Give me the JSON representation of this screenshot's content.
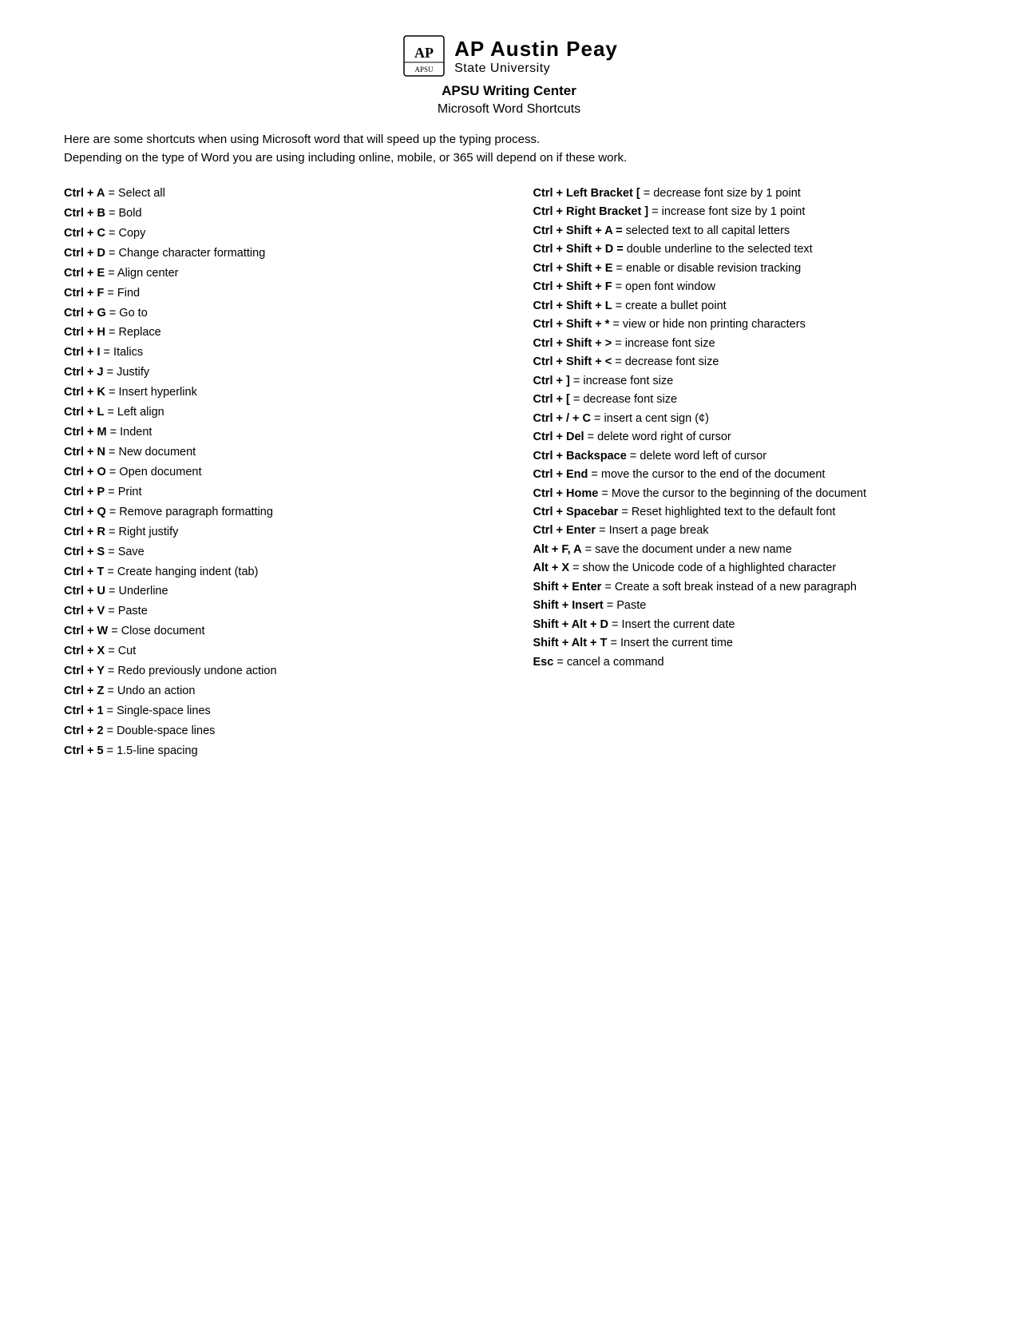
{
  "header": {
    "logo_apsu": "AP Austin Peay",
    "logo_state": "State University",
    "center_title": "APSU Writing Center",
    "sub_title": "Microsoft Word Shortcuts"
  },
  "intro": {
    "line1": "Here are some shortcuts when using Microsoft word that will speed up the typing process.",
    "line2": "Depending on the type of Word you are using including online, mobile, or 365 will depend on if these work."
  },
  "left_shortcuts": [
    {
      "key": "Ctrl + A",
      "desc": "= Select all"
    },
    {
      "key": "Ctrl + B",
      "desc": "= Bold"
    },
    {
      "key": "Ctrl + C",
      "desc": "= Copy"
    },
    {
      "key": "Ctrl + D",
      "desc": "= Change character formatting"
    },
    {
      "key": "Ctrl + E",
      "desc": "= Align center"
    },
    {
      "key": "Ctrl + F",
      "desc": "= Find"
    },
    {
      "key": "Ctrl + G",
      "desc": "= Go to"
    },
    {
      "key": "Ctrl + H",
      "desc": "= Replace"
    },
    {
      "key": "Ctrl + I",
      "desc": "= Italics"
    },
    {
      "key": "Ctrl + J",
      "desc": "= Justify"
    },
    {
      "key": "Ctrl + K",
      "desc": "= Insert hyperlink"
    },
    {
      "key": "Ctrl + L",
      "desc": "= Left align"
    },
    {
      "key": "Ctrl + M",
      "desc": "= Indent"
    },
    {
      "key": "Ctrl + N",
      "desc": "= New document"
    },
    {
      "key": "Ctrl + O",
      "desc": "= Open document"
    },
    {
      "key": "Ctrl + P",
      "desc": "= Print"
    },
    {
      "key": "Ctrl + Q",
      "desc": "= Remove paragraph formatting"
    },
    {
      "key": "Ctrl + R",
      "desc": "= Right justify"
    },
    {
      "key": "Ctrl + S",
      "desc": "= Save"
    },
    {
      "key": "Ctrl + T",
      "desc": "= Create hanging indent (tab)"
    },
    {
      "key": "Ctrl + U",
      "desc": "= Underline"
    },
    {
      "key": "Ctrl + V",
      "desc": "= Paste"
    },
    {
      "key": "Ctrl + W",
      "desc": "= Close document"
    },
    {
      "key": "Ctrl + X",
      "desc": "= Cut"
    },
    {
      "key": "Ctrl + Y",
      "desc": "= Redo previously undone action"
    },
    {
      "key": "Ctrl + Z",
      "desc": "= Undo an action"
    },
    {
      "key": "Ctrl + 1",
      "desc": "= Single-space lines"
    },
    {
      "key": "Ctrl + 2",
      "desc": "= Double-space lines"
    },
    {
      "key": "Ctrl + 5",
      "desc": "= 1.5-line spacing"
    }
  ],
  "right_shortcuts": [
    {
      "key": "Ctrl + Left Bracket [",
      "desc": "= decrease font size by 1 point"
    },
    {
      "key": "Ctrl + Right Bracket ]",
      "desc": "= increase font size by 1 point"
    },
    {
      "key": "Ctrl + Shift + A = ",
      "desc": " selected text to all capital letters"
    },
    {
      "key": "Ctrl + Shift + D = ",
      "desc": " double underline to the selected text"
    },
    {
      "key": "Ctrl + Shift + E",
      "desc": "= enable or disable revision tracking"
    },
    {
      "key": "Ctrl + Shift + F",
      "desc": "= open font window"
    },
    {
      "key": "Ctrl + Shift + L",
      "desc": "= create a bullet point"
    },
    {
      "key": "Ctrl + Shift + *",
      "desc": "= view or hide non printing characters"
    },
    {
      "key": "Ctrl + Shift + >",
      "desc": "= increase font size"
    },
    {
      "key": "Ctrl + Shift + <",
      "desc": "= decrease font size"
    },
    {
      "key": "Ctrl + ]",
      "desc": "= increase font size"
    },
    {
      "key": "Ctrl + [",
      "desc": "= decrease font size"
    },
    {
      "key": "Ctrl + / + C",
      "desc": "= insert a cent sign (¢)"
    },
    {
      "key": "Ctrl + Del",
      "desc": "= delete word right of cursor"
    },
    {
      "key": "Ctrl + Backspace",
      "desc": "= delete word left of cursor"
    },
    {
      "key": "Ctrl + End",
      "desc": "= move the cursor to the end of the document"
    },
    {
      "key": "Ctrl + Home",
      "desc": "= Move the cursor to the beginning of the document"
    },
    {
      "key": "Ctrl + Spacebar",
      "desc": "= Reset highlighted text to the default font"
    },
    {
      "key": "Ctrl + Enter",
      "desc": "= Insert a page break"
    },
    {
      "key": "Alt + F, A",
      "desc": "= save the document under a new name"
    },
    {
      "key": "Alt + X",
      "desc": "= show the Unicode code of a highlighted character"
    },
    {
      "key": "Shift + Enter",
      "desc": "= Create a soft break instead of a new paragraph"
    },
    {
      "key": "Shift + Insert",
      "desc": "= Paste"
    },
    {
      "key": "Shift + Alt + D",
      "desc": "= Insert the current date"
    },
    {
      "key": "Shift + Alt + T",
      "desc": "= Insert the current time"
    },
    {
      "key": "Esc",
      "desc": "= cancel a command"
    }
  ]
}
